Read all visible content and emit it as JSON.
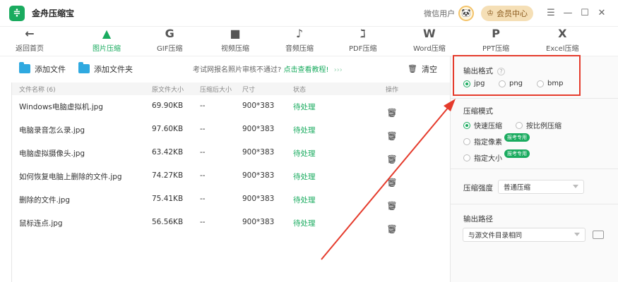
{
  "titlebar": {
    "logo_glyph": "≑",
    "app_title": "金舟压缩宝",
    "user_label": "微信用户",
    "vip_label": "会员中心",
    "icons": [
      "avatar",
      "crown-icon",
      "menu-icon",
      "minimize-icon",
      "maximize-icon",
      "close-icon"
    ]
  },
  "nav": {
    "items": [
      {
        "label": "返回首页",
        "icon": "←"
      },
      {
        "label": "图片压缩",
        "icon": "▲"
      },
      {
        "label": "GIF压缩",
        "icon": "G"
      },
      {
        "label": "视频压缩",
        "icon": "■"
      },
      {
        "label": "音频压缩",
        "icon": "♪"
      },
      {
        "label": "PDF压缩",
        "icon": "ℷ"
      },
      {
        "label": "Word压缩",
        "icon": "W"
      },
      {
        "label": "PPT压缩",
        "icon": "P"
      },
      {
        "label": "Excel压缩",
        "icon": "X"
      }
    ],
    "active_index": 1,
    "accent_color": "#1aab5f"
  },
  "toolbar": {
    "add_file": "添加文件",
    "add_folder": "添加文件夹",
    "notice_text": "考试网报名照片审核不通过?",
    "notice_link": "点击查看教程!",
    "notice_arrows": "›››",
    "clear_label": "清空"
  },
  "table": {
    "headers": {
      "name": "文件名称 (6)",
      "size": "原文件大小",
      "after": "压缩后大小",
      "dim": "尺寸",
      "status": "状态",
      "action": "操作"
    },
    "rows": [
      {
        "name": "Windows电脑虚拟机.jpg",
        "size": "69.90KB",
        "after": "--",
        "dim": "900*383",
        "status": "待处理"
      },
      {
        "name": "电脑录音怎么录.jpg",
        "size": "97.60KB",
        "after": "--",
        "dim": "900*383",
        "status": "待处理"
      },
      {
        "name": "电脑虚拟摄像头.jpg",
        "size": "63.42KB",
        "after": "--",
        "dim": "900*383",
        "status": "待处理"
      },
      {
        "name": "如何恢复电脑上删除的文件.jpg",
        "size": "74.27KB",
        "after": "--",
        "dim": "900*383",
        "status": "待处理"
      },
      {
        "name": "删除的文件.jpg",
        "size": "75.41KB",
        "after": "--",
        "dim": "900*383",
        "status": "待处理"
      },
      {
        "name": "鼠标连点.jpg",
        "size": "56.56KB",
        "after": "--",
        "dim": "900*383",
        "status": "待处理"
      }
    ],
    "action_icons": [
      "play-icon",
      "folder-open-icon",
      "trash-icon"
    ]
  },
  "panel": {
    "output_format": {
      "title": "输出格式",
      "options": [
        "jpg",
        "png",
        "bmp"
      ],
      "selected": "jpg"
    },
    "compress_mode": {
      "title": "压缩模式",
      "options": [
        "快速压缩",
        "按比例压缩",
        "指定像素",
        "指定大小"
      ],
      "selected": "快速压缩",
      "badge": "报考专用"
    },
    "strength": {
      "title": "压缩强度",
      "value": "普通压缩"
    },
    "output_path": {
      "title": "输出路径",
      "value": "与源文件目录相同"
    }
  },
  "annotation": {
    "color": "#e53b2c"
  }
}
